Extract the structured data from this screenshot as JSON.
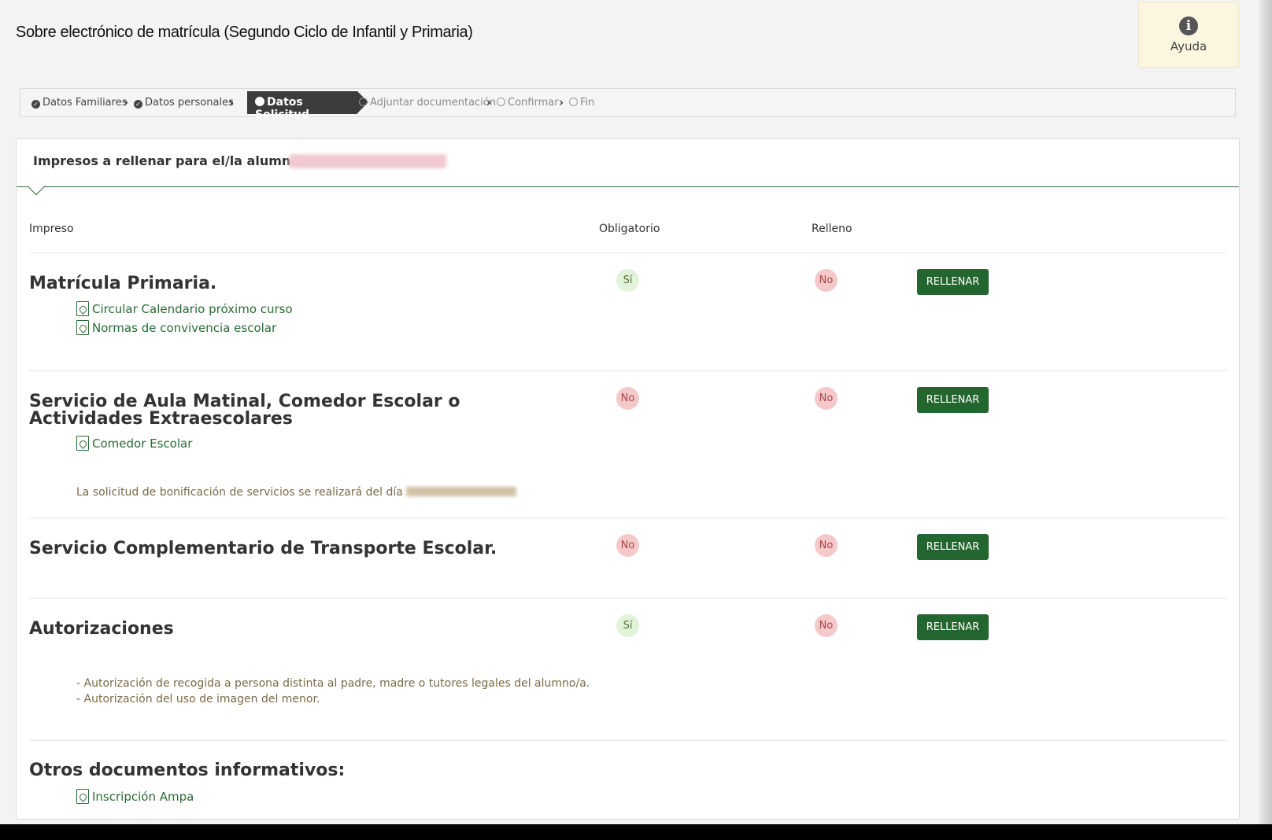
{
  "header": {
    "title": "Sobre electrónico de matrícula (Segundo Ciclo de Infantil y Primaria)",
    "help": {
      "icon": "info-circle-icon",
      "label": "Ayuda"
    }
  },
  "steps": [
    {
      "label": "Datos Familiares",
      "state": "done"
    },
    {
      "label": "Datos personales",
      "state": "done"
    },
    {
      "label": "Datos Solicitud",
      "state": "active"
    },
    {
      "label": "Adjuntar documentación",
      "state": "pending"
    },
    {
      "label": "Confirmar",
      "state": "pending"
    },
    {
      "label": "Fin",
      "state": "pending"
    }
  ],
  "panel": {
    "heading": "Impresos a rellenar para el/la alumno/a:",
    "columns": {
      "impreso": "Impreso",
      "obligatorio": "Obligatorio",
      "relleno": "Relleno"
    },
    "rows": [
      {
        "title": "Matrícula Primaria.",
        "obligatorio": "Sí",
        "relleno": "No",
        "button": "RELLENAR",
        "links": [
          "Circular Calendario próximo curso",
          "Normas de convivencia escolar"
        ]
      },
      {
        "title_line1": "Servicio de Aula Matinal, Comedor Escolar o",
        "title_line2": "Actividades Extraescolares",
        "obligatorio": "No",
        "relleno": "No",
        "button": "RELLENAR",
        "links": [
          "Comedor Escolar"
        ],
        "note": "La solicitud de bonificación de servicios se realizará del día"
      },
      {
        "title": "Servicio Complementario de Transporte Escolar.",
        "obligatorio": "No",
        "relleno": "No",
        "button": "RELLENAR"
      },
      {
        "title": "Autorizaciones",
        "obligatorio": "Sí",
        "relleno": "No",
        "button": "RELLENAR",
        "notes": [
          "- Autorización de recogida a persona distinta al padre, madre o tutores legales del alumno/a.",
          "- Autorización del uso de imagen del menor."
        ]
      }
    ],
    "others": {
      "title": "Otros documentos informativos:",
      "links": [
        "Inscripción Ampa"
      ]
    }
  },
  "colors": {
    "accent": "#24662f",
    "yes_bg": "#e1f3d9",
    "no_bg": "#f5c9c9",
    "help_bg": "#fbf6df"
  }
}
